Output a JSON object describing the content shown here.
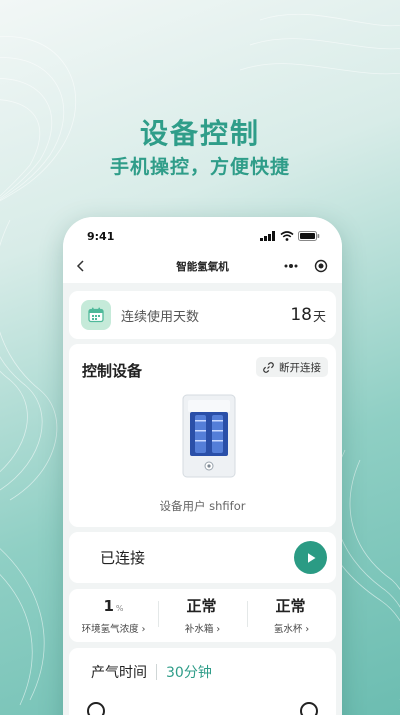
{
  "promo": {
    "headline": "设备控制",
    "subline": "手机操控，方便快捷"
  },
  "status_bar": {
    "time": "9:41"
  },
  "nav": {
    "title": "智能氢氧机",
    "more_icon": "more-dots-icon",
    "close_icon": "target-close-icon"
  },
  "usage": {
    "label": "连续使用天数",
    "value": "18",
    "unit": "天",
    "icon": "calendar-icon"
  },
  "control": {
    "title": "控制设备",
    "disconnect_label": "断开连接",
    "device_user": "设备用户 shfifor"
  },
  "connection": {
    "status": "已连接",
    "action_icon": "play-icon"
  },
  "stats": [
    {
      "value": "1",
      "unit": "%",
      "label": "环境氢气浓度 ›"
    },
    {
      "value": "正常",
      "unit": "",
      "label": "补水箱 ›"
    },
    {
      "value": "正常",
      "unit": "",
      "label": "氢水杯 ›"
    }
  ],
  "gas": {
    "label": "产气时间",
    "value": "30分钟"
  },
  "colors": {
    "accent": "#2f9d89",
    "play_button": "#2b9b84",
    "calendar_bg": "#c5ead9"
  }
}
